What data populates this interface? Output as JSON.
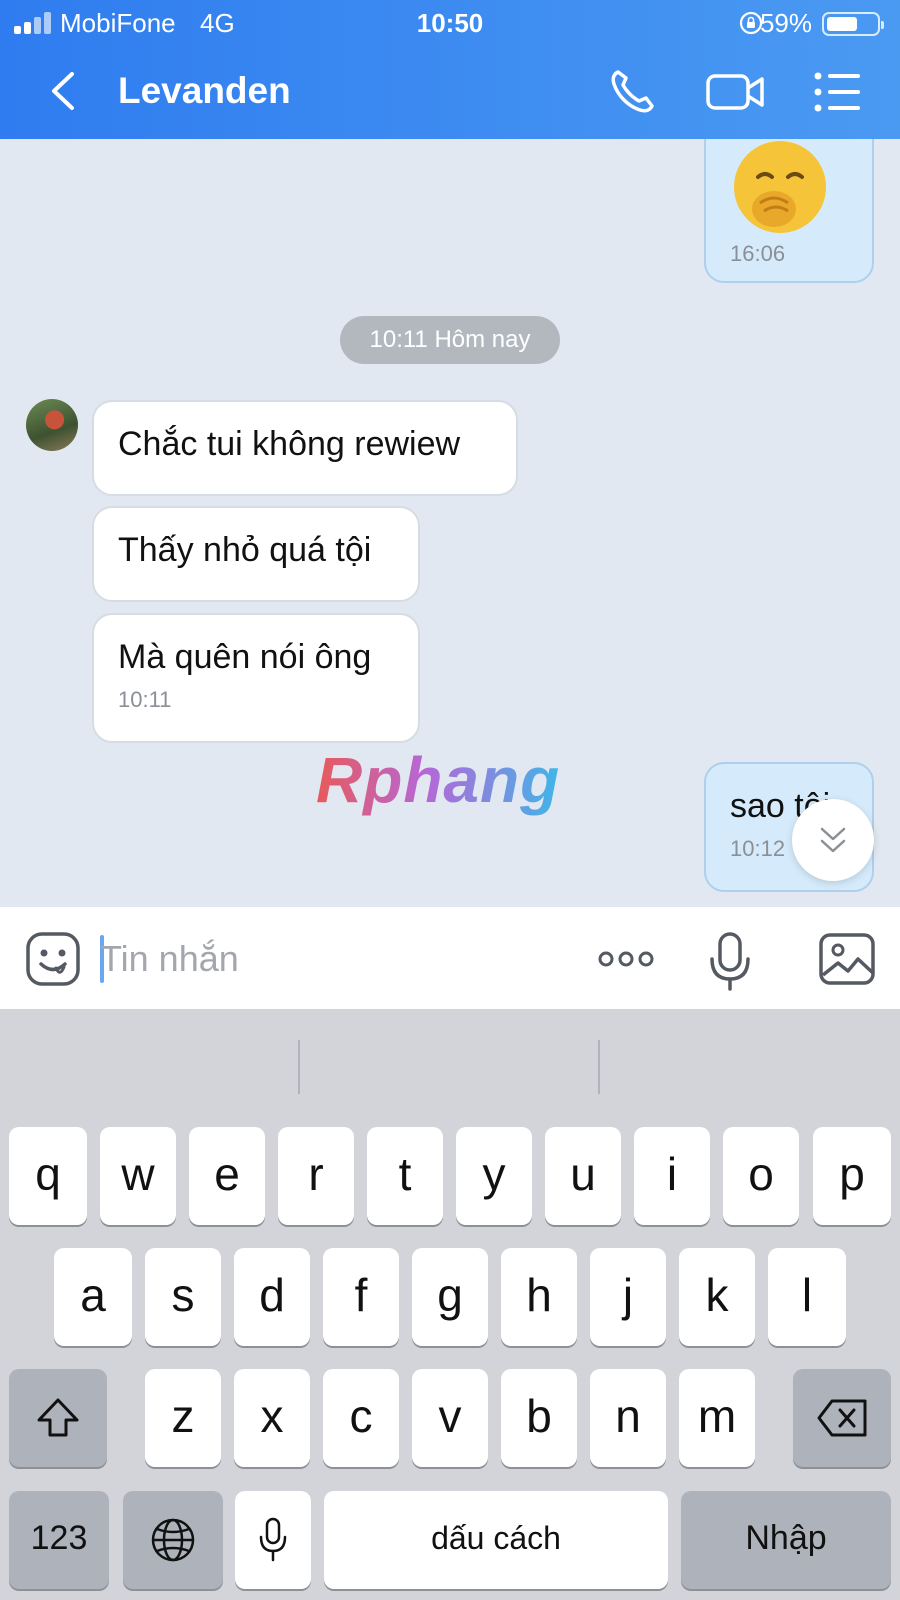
{
  "status_bar": {
    "carrier": "MobiFone",
    "network": "4G",
    "time": "10:50",
    "battery": "59%"
  },
  "header": {
    "title": "Levanden"
  },
  "chat": {
    "messages": [
      {
        "sender": "self",
        "type": "sticker",
        "time": "16:06"
      },
      {
        "sender": "contact",
        "text": "Chắc tui không rewiew"
      },
      {
        "sender": "contact",
        "text": "Thấy nhỏ quá tội"
      },
      {
        "sender": "contact",
        "text": "Mà quên nói ông",
        "time": "10:11"
      },
      {
        "sender": "self",
        "text": "sao tội",
        "time": "10:12"
      }
    ],
    "date_separator": "10:11 Hôm nay",
    "watermark": "Rphang"
  },
  "composer": {
    "placeholder": "Tin nhắn"
  },
  "keyboard": {
    "row1": [
      "q",
      "w",
      "e",
      "r",
      "t",
      "y",
      "u",
      "i",
      "o",
      "p"
    ],
    "row2": [
      "a",
      "s",
      "d",
      "f",
      "g",
      "h",
      "j",
      "k",
      "l"
    ],
    "row3": [
      "z",
      "x",
      "c",
      "v",
      "b",
      "n",
      "m"
    ],
    "numbers_label": "123",
    "space_label": "dấu cách",
    "return_label": "Nhập"
  },
  "icons": {
    "back": "chevron-left-icon",
    "call": "phone-icon",
    "video": "video-camera-icon",
    "menu": "list-menu-icon",
    "emoji": "smiley-icon",
    "more": "ellipsis-icon",
    "voice": "microphone-icon",
    "image": "image-icon"
  },
  "colors": {
    "header_start": "#2f7cf0",
    "header_end": "#4a9af2",
    "incoming_bubble": "#ffffff",
    "outgoing_bubble": "#d5ebfb",
    "chat_background": "#e2e8f1"
  }
}
